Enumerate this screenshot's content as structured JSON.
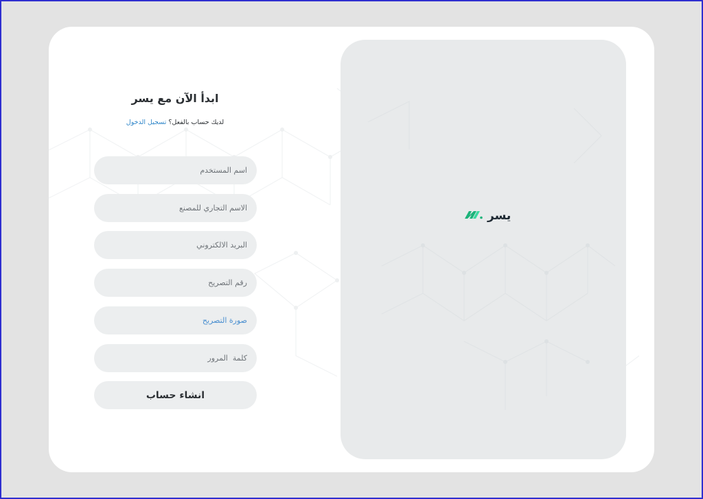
{
  "form": {
    "title": "ابدأ الآن مع يسر",
    "subtitle_prefix": "لديك حساب بالفعل؟",
    "login_link": "تسجيل الدخول",
    "fields": {
      "username_placeholder": "اسم المستخدم",
      "factory_name_placeholder": "الاسم التجاري للمصنع",
      "email_placeholder": "البريد الالكتروني",
      "license_number_placeholder": "رقم التصريح",
      "license_image_label": "صورة التصريح",
      "password_placeholder": "كلمة  المرور"
    },
    "submit_label": "انشاء حساب"
  },
  "brand": {
    "name": "يسر",
    "logo_icon": "yusr-logo-icon",
    "logo_colors": [
      "#1db37a",
      "#3ad9a0"
    ]
  },
  "colors": {
    "page_background": "#e3e3e3",
    "card_background": "#ffffff",
    "panel_background": "#e8eaeb",
    "input_background": "#eceeef",
    "link": "#2f86c9"
  }
}
